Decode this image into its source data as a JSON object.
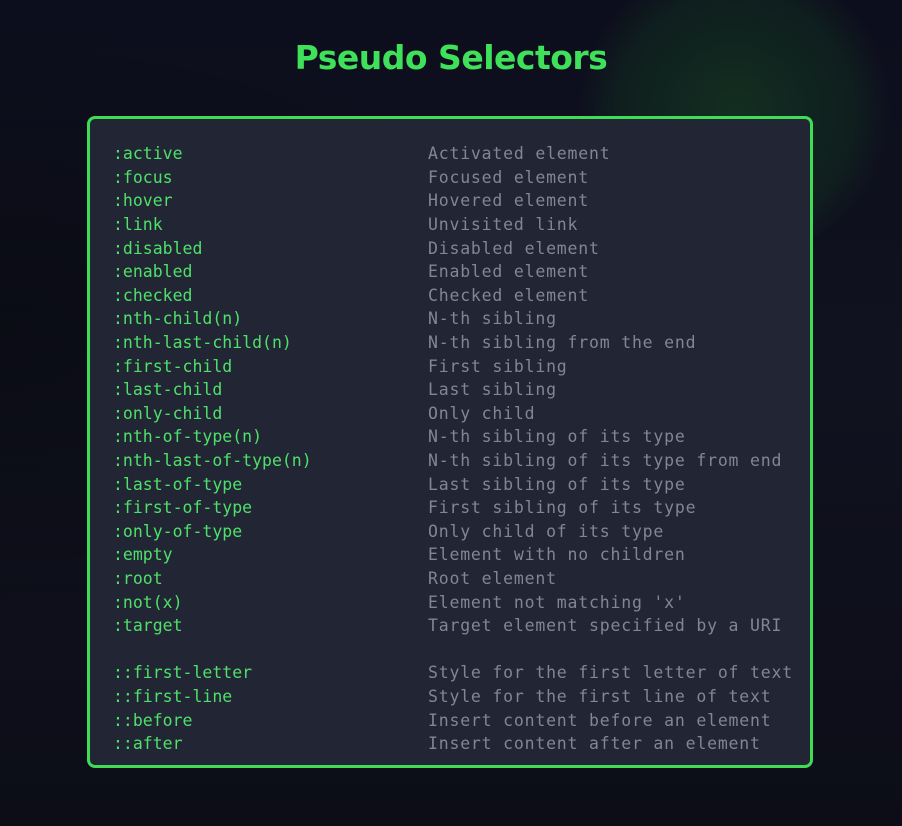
{
  "title": "Pseudo Selectors",
  "colors": {
    "accent": "#3fe05a",
    "panel_border": "#3fdc55",
    "panel_bg": "#222634",
    "selector_text": "#4ee06a",
    "description_text": "#818694",
    "background": "#0f111e"
  },
  "pseudo_classes": [
    {
      "selector": ":active",
      "description": "Activated element"
    },
    {
      "selector": ":focus",
      "description": "Focused element"
    },
    {
      "selector": ":hover",
      "description": "Hovered element"
    },
    {
      "selector": ":link",
      "description": "Unvisited link"
    },
    {
      "selector": ":disabled",
      "description": "Disabled element"
    },
    {
      "selector": ":enabled",
      "description": "Enabled element"
    },
    {
      "selector": ":checked",
      "description": "Checked element"
    },
    {
      "selector": ":nth-child(n)",
      "description": "N-th sibling"
    },
    {
      "selector": ":nth-last-child(n)",
      "description": "N-th sibling from the end"
    },
    {
      "selector": ":first-child",
      "description": "First sibling"
    },
    {
      "selector": ":last-child",
      "description": "Last sibling"
    },
    {
      "selector": ":only-child",
      "description": "Only child"
    },
    {
      "selector": ":nth-of-type(n)",
      "description": "N-th sibling of its type"
    },
    {
      "selector": ":nth-last-of-type(n)",
      "description": "N-th sibling of its type from end"
    },
    {
      "selector": ":last-of-type",
      "description": "Last sibling of its type"
    },
    {
      "selector": ":first-of-type",
      "description": "First sibling of its type"
    },
    {
      "selector": ":only-of-type",
      "description": "Only child of its type"
    },
    {
      "selector": ":empty",
      "description": "Element with no children"
    },
    {
      "selector": ":root",
      "description": "Root element"
    },
    {
      "selector": ":not(x)",
      "description": "Element not matching 'x'"
    },
    {
      "selector": ":target",
      "description": "Target element specified by a URI"
    }
  ],
  "pseudo_elements": [
    {
      "selector": "::first-letter",
      "description": "Style for the first letter of text"
    },
    {
      "selector": "::first-line",
      "description": "Style for the first line of text"
    },
    {
      "selector": "::before",
      "description": "Insert content before an element"
    },
    {
      "selector": "::after",
      "description": "Insert content after an element"
    }
  ]
}
